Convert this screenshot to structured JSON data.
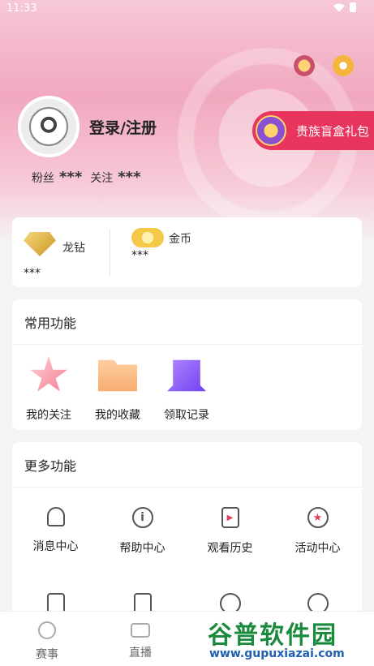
{
  "status_bar": {
    "time": "11:33",
    "wifi_icon": "wifi-icon",
    "battery_icon": "battery-icon"
  },
  "header": {
    "crown_icon": "crown-icon",
    "settings_icon": "gear-icon",
    "login_label": "登录/注册",
    "gift_button_label": "贵族盲盒礼包",
    "fans_label": "粉丝",
    "fans_value": "***",
    "follow_label": "关注",
    "follow_value": "***"
  },
  "wallet": {
    "diamond_label": "龙钻",
    "diamond_value": "***",
    "coin_label": "金币",
    "coin_value": "***"
  },
  "common_functions": {
    "title": "常用功能",
    "items": [
      {
        "label": "我的关注",
        "icon": "star-icon"
      },
      {
        "label": "我的收藏",
        "icon": "folder-icon"
      },
      {
        "label": "领取记录",
        "icon": "record-icon"
      }
    ]
  },
  "more_functions": {
    "title": "更多功能",
    "items": [
      {
        "label": "消息中心",
        "icon": "bell-icon"
      },
      {
        "label": "帮助中心",
        "icon": "info-icon"
      },
      {
        "label": "观看历史",
        "icon": "history-icon"
      },
      {
        "label": "活动中心",
        "icon": "activity-icon"
      }
    ]
  },
  "bottom_nav": {
    "items": [
      {
        "label": "赛事",
        "icon": "football-icon"
      },
      {
        "label": "直播",
        "icon": "camera-icon"
      }
    ]
  },
  "watermark": {
    "title": "谷普软件园",
    "url": "www.gupuxiazai.com"
  },
  "colors": {
    "accent": "#e8355e",
    "header_pink": "#f1a8be",
    "coin_gold": "#f5c947"
  }
}
